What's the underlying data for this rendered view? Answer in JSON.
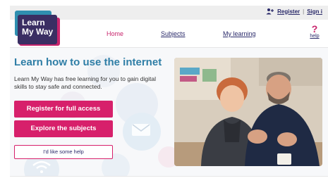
{
  "logo": {
    "text": "Learn My Way"
  },
  "top_links": {
    "register": "Register",
    "sign_in": "Sign i"
  },
  "nav": {
    "home": "Home",
    "subjects": "Subjects",
    "my_learning": "My learning"
  },
  "help": {
    "glyph": "?",
    "label": "help"
  },
  "hero": {
    "title": "Learn how to use the internet",
    "intro": "Learn My Way has free learning for you to gain digital skills to stay safe and connected.",
    "register_button": "Register for full access",
    "explore_button": "Explore the subjects",
    "help_button": "I'd like some help"
  },
  "colors": {
    "brand_pink": "#d7206b",
    "title_blue": "#2f7ea6",
    "logo_navy": "#3a2e63",
    "logo_teal": "#2f8fb0"
  },
  "icons": [
    "person-add-icon",
    "question-icon",
    "envelope-icon",
    "wifi-icon"
  ]
}
